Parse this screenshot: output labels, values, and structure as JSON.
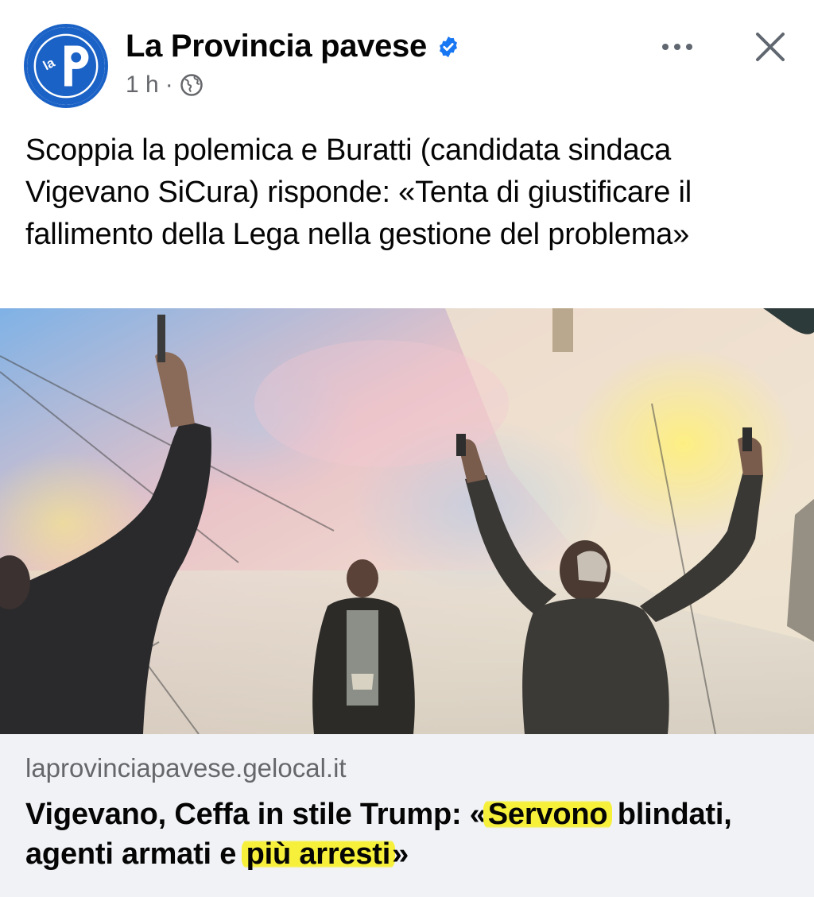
{
  "post": {
    "page_name": "La Provincia pavese",
    "time": "1 h",
    "separator": "·",
    "audience_icon": "globe-icon",
    "more_icon": "more-horizontal-icon",
    "close_icon": "close-icon",
    "text": "Scoppia la polemica e Buratti (candidata sindaca Vigevano SiCura) risponde: «Tenta di giustificare il fallimento della Lega nella gestione del problema»"
  },
  "avatar": {
    "logo_text": "la P"
  },
  "link_card": {
    "domain": "laprovinciapavese.gelocal.it",
    "title_part1": "Vigevano, Ceffa in stile Trump: «",
    "title_highlight1": "Servono",
    "title_part2": " blindati, agenti armati e ",
    "title_highlight2": "più arresti",
    "title_part3": "»"
  },
  "colors": {
    "brand_blue": "#1b62c6",
    "verified_blue": "#1877f2",
    "meta_gray": "#65676b",
    "card_bg": "#f0f2f5",
    "highlight": "#f6f03a"
  }
}
